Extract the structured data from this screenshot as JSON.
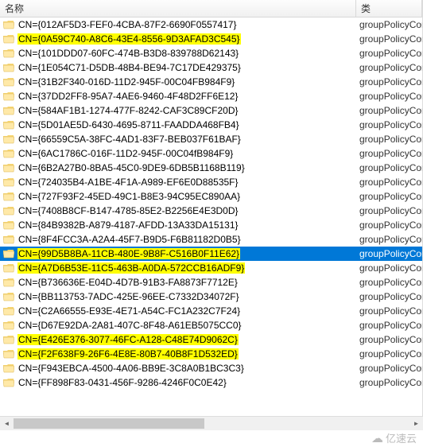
{
  "columns": {
    "name": "名称",
    "type": "类"
  },
  "type_value": "groupPolicyContaine",
  "rows": [
    {
      "label": "CN={012AF5D3-FEF0-4CBA-87F2-6690F0557417}",
      "highlight": false,
      "selected": false
    },
    {
      "label": "CN={0A59C740-A8C6-43E4-8556-9D3AFAD3C545}",
      "highlight": true,
      "selected": false
    },
    {
      "label": "CN={101DDD07-60FC-474B-B3D8-839788D62143}",
      "highlight": false,
      "selected": false
    },
    {
      "label": "CN={1E054C71-D5DB-48B4-BE94-7C17DE429375}",
      "highlight": false,
      "selected": false
    },
    {
      "label": "CN={31B2F340-016D-11D2-945F-00C04FB984F9}",
      "highlight": false,
      "selected": false
    },
    {
      "label": "CN={37DD2FF8-95A7-4AE6-9460-4F48D2FF6E12}",
      "highlight": false,
      "selected": false
    },
    {
      "label": "CN={584AF1B1-1274-477F-8242-CAF3C89CF20D}",
      "highlight": false,
      "selected": false
    },
    {
      "label": "CN={5D01AE5D-6430-4695-8711-FAADDA468FB4}",
      "highlight": false,
      "selected": false
    },
    {
      "label": "CN={66559C5A-38FC-4AD1-83F7-BEB037F61BAF}",
      "highlight": false,
      "selected": false
    },
    {
      "label": "CN={6AC1786C-016F-11D2-945F-00C04fB984F9}",
      "highlight": false,
      "selected": false
    },
    {
      "label": "CN={6B2A27B0-8BA5-45C0-9DE9-6DB5B1168B119}",
      "highlight": false,
      "selected": false
    },
    {
      "label": "CN={724035B4-A1BE-4F1A-A989-EF6E0D88535F}",
      "highlight": false,
      "selected": false
    },
    {
      "label": "CN={727F93F2-45ED-49C1-B8E3-94C95EC890AA}",
      "highlight": false,
      "selected": false
    },
    {
      "label": "CN={7408B8CF-B147-4785-85E2-B2256E4E3D0D}",
      "highlight": false,
      "selected": false
    },
    {
      "label": "CN={84B9382B-A879-4187-AFDD-13A33DA15131}",
      "highlight": false,
      "selected": false
    },
    {
      "label": "CN={8F4FCC3A-A2A4-45F7-B9D5-F6B81182D0B5}",
      "highlight": false,
      "selected": false
    },
    {
      "label": "CN={99D5B8BA-11CB-480E-9B8F-C516B0F11E62}",
      "highlight": true,
      "selected": true
    },
    {
      "label": "CN={A7D6B53E-11C5-463B-A0DA-572CCB16ADF9}",
      "highlight": true,
      "selected": false
    },
    {
      "label": "CN={B736636E-E04D-4D7B-91B3-FA8873F7712E}",
      "highlight": false,
      "selected": false
    },
    {
      "label": "CN={BB113753-7ADC-425E-96EE-C7332D34072F}",
      "highlight": false,
      "selected": false
    },
    {
      "label": "CN={C2A66555-E93E-4E71-A54C-FC1A232C7F24}",
      "highlight": false,
      "selected": false
    },
    {
      "label": "CN={D67E92DA-2A81-407C-8F48-A61EB5075CC0}",
      "highlight": false,
      "selected": false
    },
    {
      "label": "CN={E426E376-3077-46FC-A128-C48E74D9062C}",
      "highlight": true,
      "selected": false
    },
    {
      "label": "CN={F2F638F9-26F6-4E8E-80B7-40B8F1D532ED}",
      "highlight": true,
      "selected": false
    },
    {
      "label": "CN={F943EBCA-4500-4A06-BB9E-3C8A0B1BC3C3}",
      "highlight": false,
      "selected": false
    },
    {
      "label": "CN={FF898F83-0431-456F-9286-4246F0C0E42}",
      "highlight": false,
      "selected": false
    }
  ],
  "watermark": "亿速云"
}
